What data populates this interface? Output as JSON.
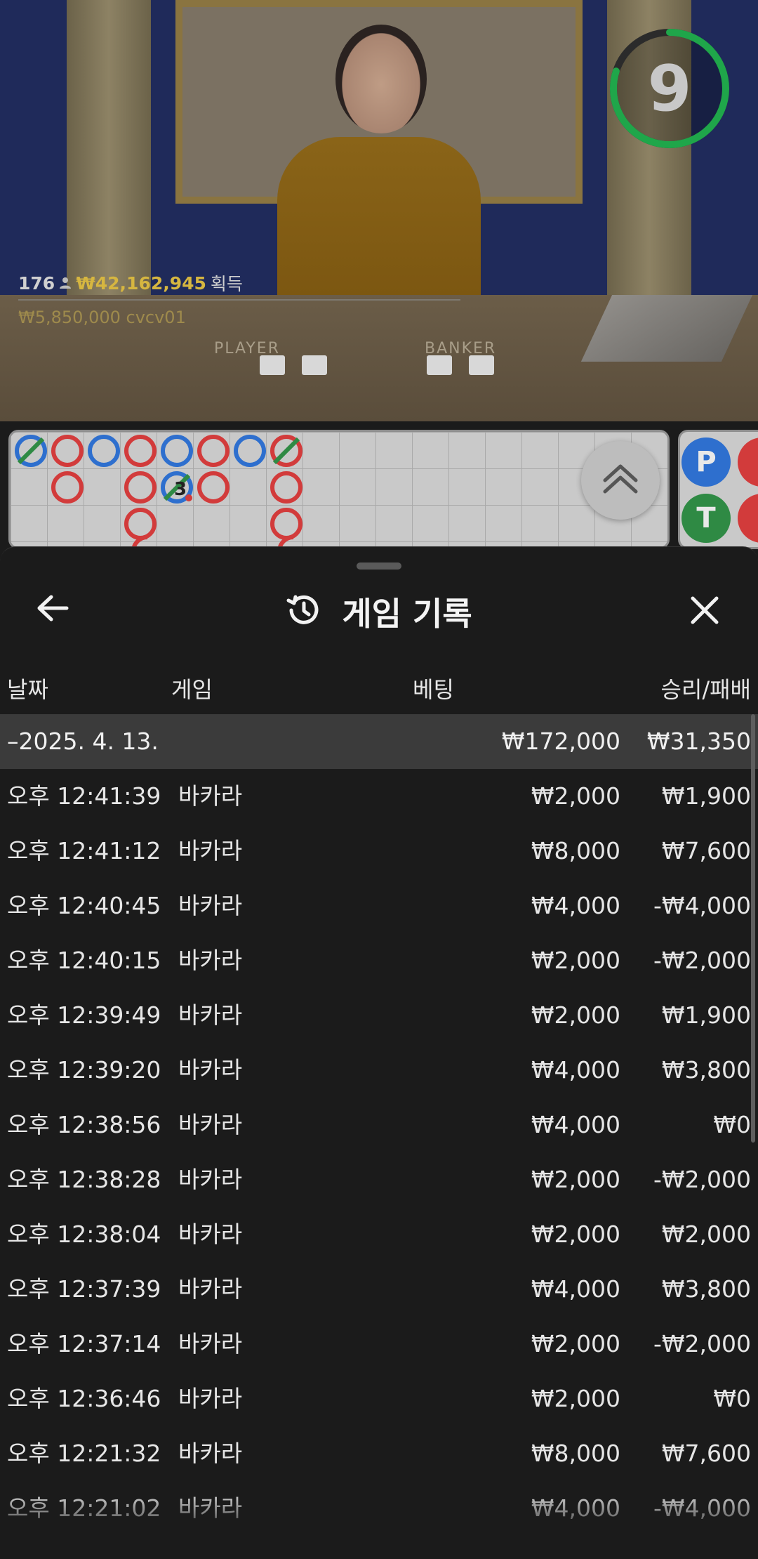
{
  "video": {
    "timer": "9",
    "table_labels": [
      "PLAYER",
      "BANKER"
    ],
    "win_info": {
      "count": "176",
      "amount": "₩42,162,945",
      "label": "획득"
    },
    "win_sub": "₩5,850,000  cvcv01"
  },
  "roadmap": {
    "side_beads": [
      "P",
      "T"
    ]
  },
  "sheet": {
    "title": "게임 기록",
    "columns": {
      "date": "날짜",
      "game": "게임",
      "bet": "베팅",
      "winloss": "승리/패배"
    },
    "date_group": {
      "date": "–2025. 4. 13.",
      "bet_total": "₩172,000",
      "win_total": "₩31,350"
    },
    "rows": [
      {
        "time": "오후 12:41:39",
        "game": "바카라",
        "bet": "₩2,000",
        "result": "₩1,900"
      },
      {
        "time": "오후 12:41:12",
        "game": "바카라",
        "bet": "₩8,000",
        "result": "₩7,600"
      },
      {
        "time": "오후 12:40:45",
        "game": "바카라",
        "bet": "₩4,000",
        "result": "-₩4,000"
      },
      {
        "time": "오후 12:40:15",
        "game": "바카라",
        "bet": "₩2,000",
        "result": "-₩2,000"
      },
      {
        "time": "오후 12:39:49",
        "game": "바카라",
        "bet": "₩2,000",
        "result": "₩1,900"
      },
      {
        "time": "오후 12:39:20",
        "game": "바카라",
        "bet": "₩4,000",
        "result": "₩3,800"
      },
      {
        "time": "오후 12:38:56",
        "game": "바카라",
        "bet": "₩4,000",
        "result": "₩0"
      },
      {
        "time": "오후 12:38:28",
        "game": "바카라",
        "bet": "₩2,000",
        "result": "-₩2,000"
      },
      {
        "time": "오후 12:38:04",
        "game": "바카라",
        "bet": "₩2,000",
        "result": "₩2,000"
      },
      {
        "time": "오후 12:37:39",
        "game": "바카라",
        "bet": "₩4,000",
        "result": "₩3,800"
      },
      {
        "time": "오후 12:37:14",
        "game": "바카라",
        "bet": "₩2,000",
        "result": "-₩2,000"
      },
      {
        "time": "오후 12:36:46",
        "game": "바카라",
        "bet": "₩2,000",
        "result": "₩0"
      },
      {
        "time": "오후 12:21:32",
        "game": "바카라",
        "bet": "₩8,000",
        "result": "₩7,600"
      },
      {
        "time": "오후 12:21:02",
        "game": "바카라",
        "bet": "₩4,000",
        "result": "-₩4,000"
      }
    ]
  },
  "colors": {
    "timer_ring": "#1fa64a",
    "win_amount": "#d6b640",
    "banker": "#d23b3b",
    "player": "#2e6fce",
    "tie": "#2f8a44"
  }
}
